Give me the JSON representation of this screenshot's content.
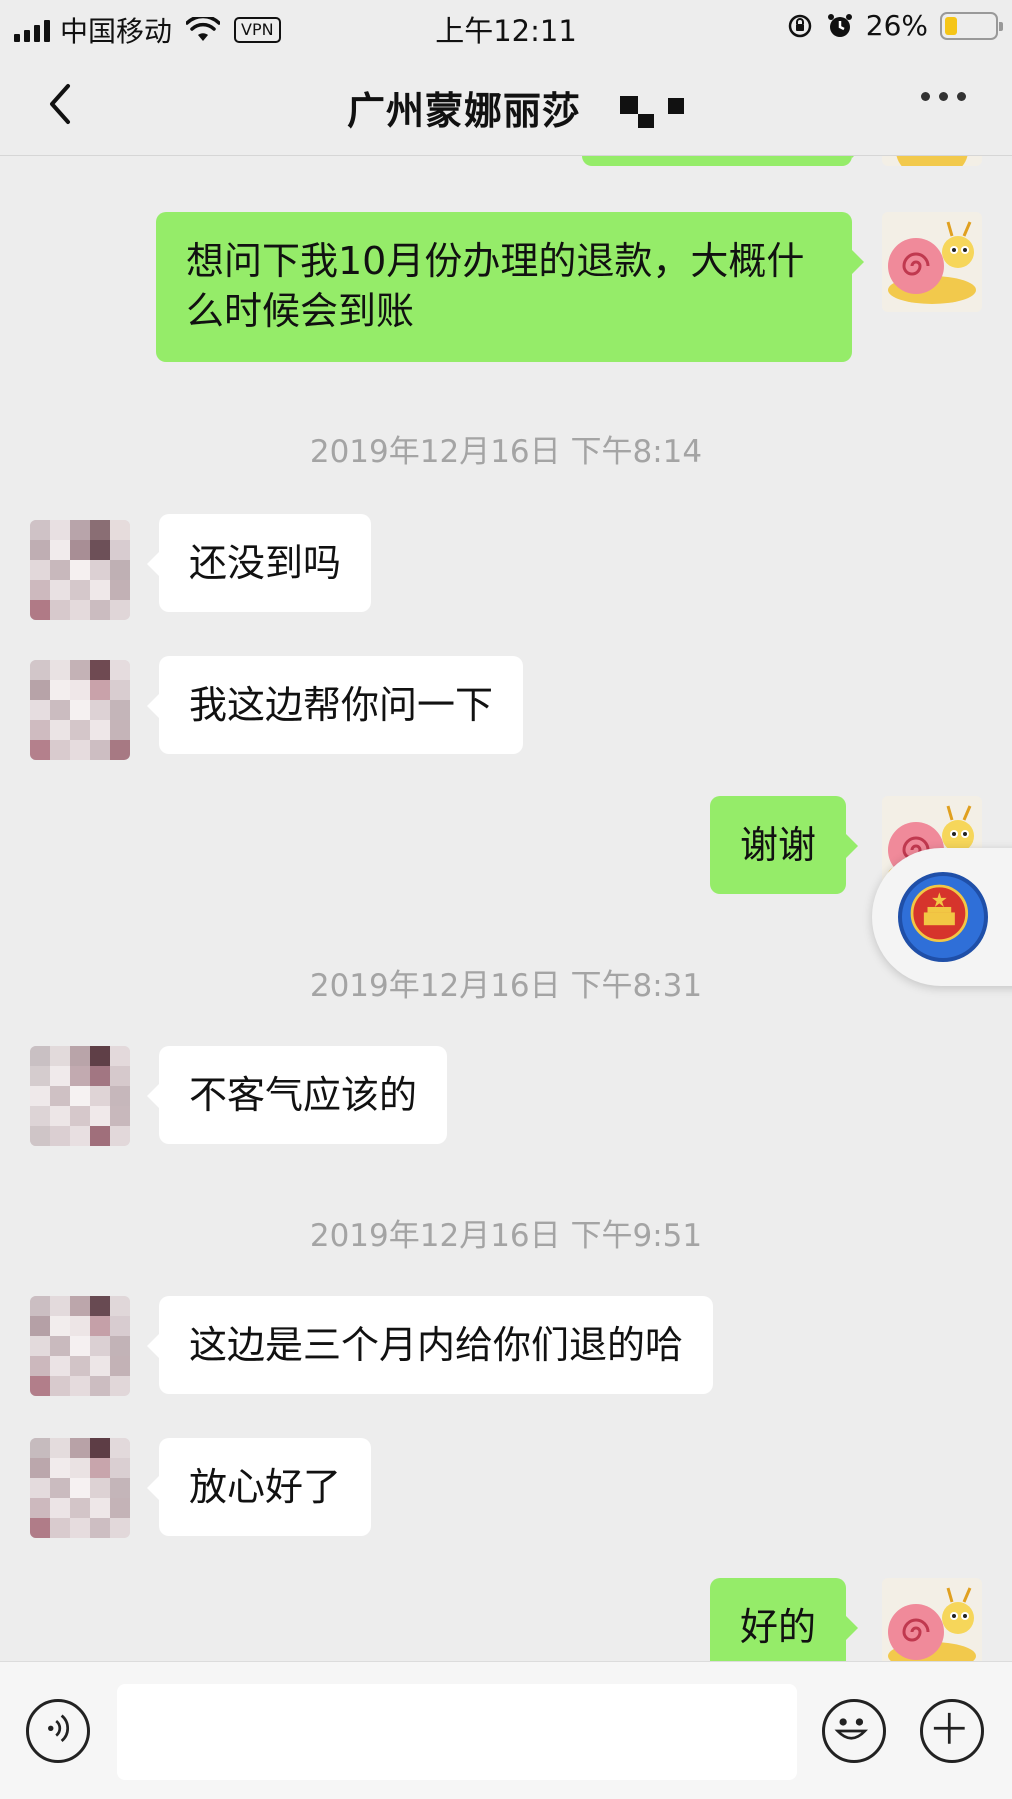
{
  "status_bar": {
    "carrier": "中国移动",
    "vpn_label": "VPN",
    "time": "上午12:11",
    "battery_percent": "26%",
    "battery_level": 0.26,
    "icons": [
      "signal-icon",
      "wifi-icon",
      "orientation-lock-icon",
      "alarm-icon",
      "battery-icon"
    ]
  },
  "nav": {
    "title": "广州蒙娜丽莎",
    "icons": [
      "back-icon",
      "more-icon"
    ]
  },
  "messages": [
    {
      "type": "out",
      "text": "想问下我10月份办理的退款，大概什么时候会到账"
    },
    {
      "type": "time",
      "text": "2019年12月16日 下午8:14"
    },
    {
      "type": "in",
      "text": "还没到吗"
    },
    {
      "type": "in",
      "text": "我这边帮你问一下"
    },
    {
      "type": "out",
      "text": "谢谢"
    },
    {
      "type": "time",
      "text": "2019年12月16日 下午8:31"
    },
    {
      "type": "in",
      "text": "不客气应该的"
    },
    {
      "type": "time",
      "text": "2019年12月16日 下午9:51"
    },
    {
      "type": "in",
      "text": "这边是三个月内给你们退的哈"
    },
    {
      "type": "in",
      "text": "放心好了"
    },
    {
      "type": "out",
      "text": "好的"
    }
  ],
  "input_bar": {
    "value": "",
    "icons": [
      "voice-icon",
      "emoji-icon",
      "plus-icon"
    ]
  },
  "colors": {
    "background": "#ededed",
    "outgoing_bubble": "#95ec69",
    "incoming_bubble": "#ffffff",
    "timestamp": "#a4a4a4",
    "battery": "#f5c518"
  }
}
